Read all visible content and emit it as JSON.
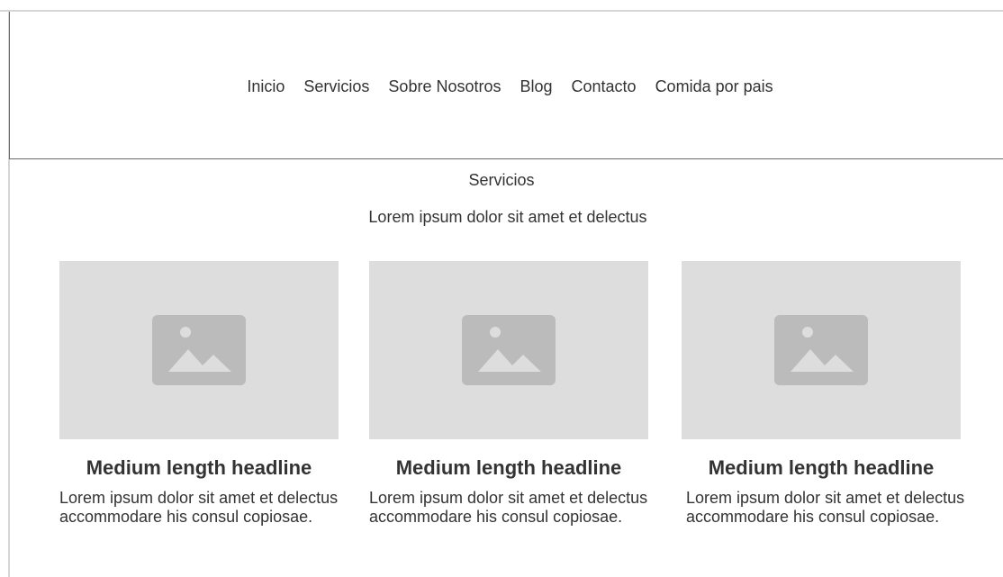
{
  "nav": {
    "items": [
      {
        "label": "Inicio"
      },
      {
        "label": "Servicios"
      },
      {
        "label": "Sobre Nosotros"
      },
      {
        "label": "Blog"
      },
      {
        "label": "Contacto"
      },
      {
        "label": "Comida por pais"
      }
    ]
  },
  "section": {
    "title": "Servicios",
    "subtitle": "Lorem ipsum dolor sit amet et delectus"
  },
  "cards": [
    {
      "icon": "image-placeholder-icon",
      "headline": "Medium length headline",
      "text": "Lorem ipsum dolor sit amet et delectus accommodare his consul copiosae."
    },
    {
      "icon": "image-placeholder-icon",
      "headline": "Medium length headline",
      "text": "Lorem ipsum dolor sit amet et delectus accommodare his consul copiosae."
    },
    {
      "icon": "image-placeholder-icon",
      "headline": "Medium length headline",
      "text": "Lorem ipsum dolor sit amet et delectus accommodare his consul copiosae."
    }
  ],
  "colors": {
    "placeholder_bg": "#dddddd",
    "placeholder_icon": "#bbbbbb",
    "text": "#333333"
  }
}
